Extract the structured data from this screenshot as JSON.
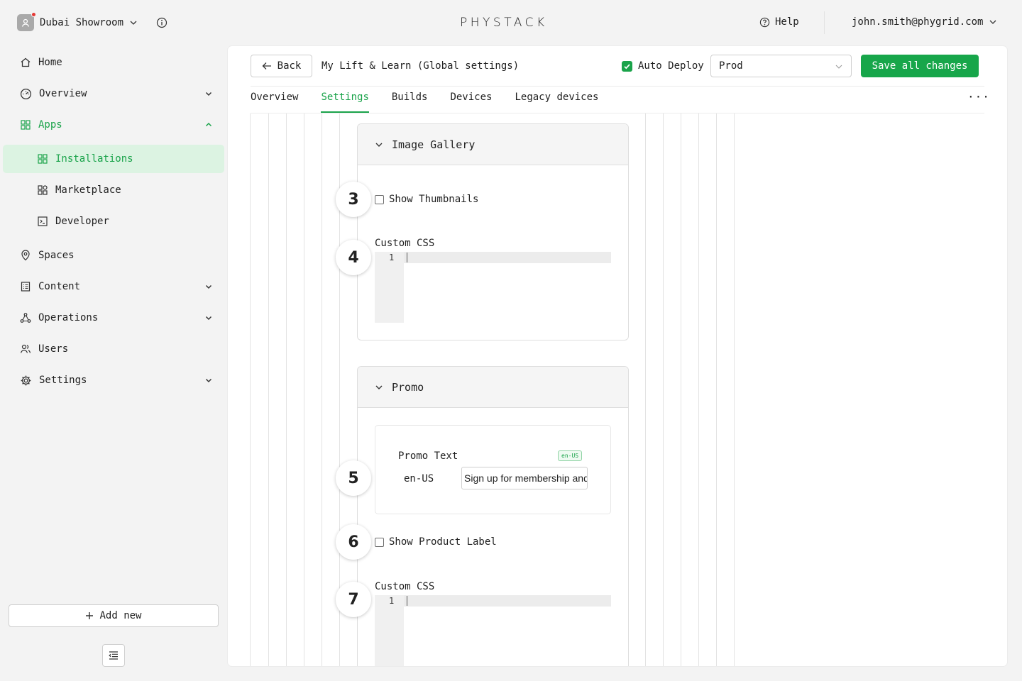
{
  "topbar": {
    "org_name": "Dubai Showroom",
    "logo": "PHYSTACK",
    "help_label": "Help",
    "user_email": "john.smith@phygrid.com"
  },
  "sidebar": {
    "items": [
      {
        "label": "Home",
        "icon": "home-icon"
      },
      {
        "label": "Overview",
        "icon": "dashboard-icon",
        "expandable": true
      },
      {
        "label": "Apps",
        "icon": "apps-icon",
        "expanded": true
      },
      {
        "label": "Spaces",
        "icon": "location-pin-icon"
      },
      {
        "label": "Content",
        "icon": "content-icon",
        "expandable": true
      },
      {
        "label": "Operations",
        "icon": "operations-icon",
        "expandable": true
      },
      {
        "label": "Users",
        "icon": "users-icon"
      },
      {
        "label": "Settings",
        "icon": "gear-icon",
        "expandable": true
      }
    ],
    "apps_children": [
      {
        "label": "Installations",
        "icon": "grid-icon",
        "active": true
      },
      {
        "label": "Marketplace",
        "icon": "marketplace-icon"
      },
      {
        "label": "Developer",
        "icon": "terminal-icon"
      }
    ],
    "add_new_label": "Add new"
  },
  "header": {
    "back_label": "Back",
    "title": "My Lift & Learn (Global settings)",
    "auto_deploy_label": "Auto Deploy",
    "auto_deploy_checked": true,
    "environment": "Prod",
    "save_label": "Save all changes"
  },
  "tabs": [
    {
      "label": "Overview"
    },
    {
      "label": "Settings",
      "active": true
    },
    {
      "label": "Builds"
    },
    {
      "label": "Devices"
    },
    {
      "label": "Legacy devices"
    }
  ],
  "image_gallery": {
    "title": "Image Gallery",
    "show_thumbnails_label": "Show Thumbnails",
    "show_thumbnails_checked": false,
    "custom_css_label": "Custom CSS",
    "line_number": "1"
  },
  "promo": {
    "title": "Promo",
    "promo_text_label": "Promo Text",
    "locale_badge": "en-US",
    "locale_label": "en-US",
    "promo_text_value": "Sign up for membership and",
    "show_product_label": "Show Product Label",
    "show_product_checked": false,
    "custom_css_label": "Custom CSS",
    "line_number": "1"
  },
  "steps": [
    "3",
    "4",
    "5",
    "6",
    "7"
  ],
  "colors": {
    "accent": "#1aa34a",
    "accent_bg": "#dcf3e2",
    "save_button": "#17a64a",
    "notification_dot": "#e53935"
  }
}
